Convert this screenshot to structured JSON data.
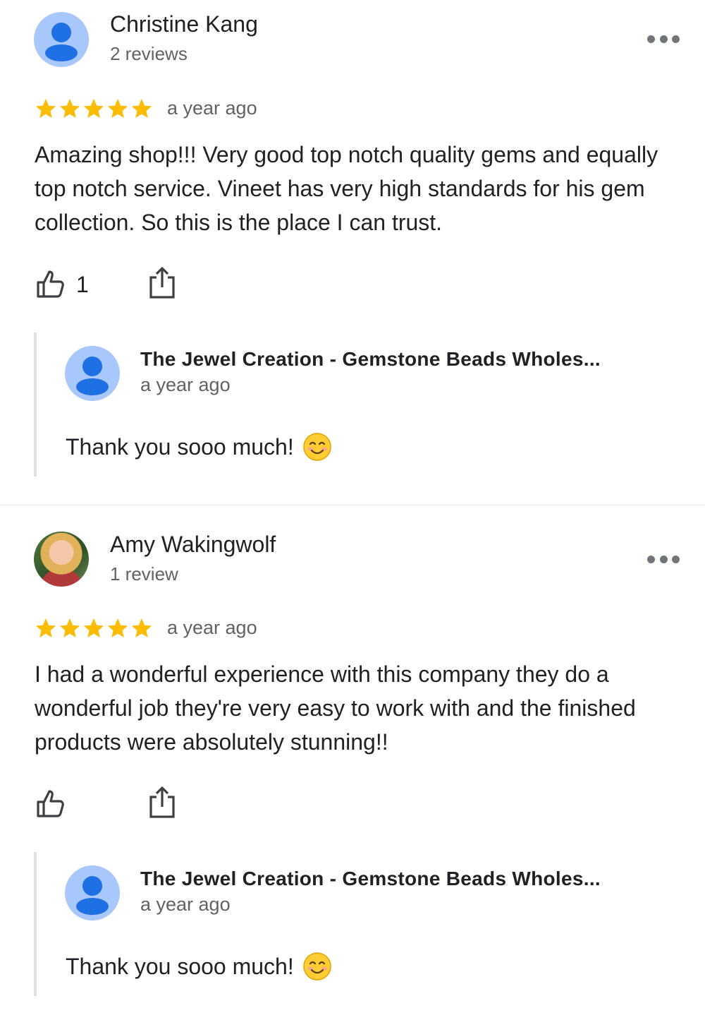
{
  "reviews": [
    {
      "reviewer_name": "Christine Kang",
      "reviewer_count": "2 reviews",
      "rating": 5,
      "time": "a year ago",
      "text": "Amazing shop!!! Very good top notch quality gems and equally top notch service. Vineet has very high standards for his gem collection. So this is the place I can trust.",
      "likes": "1",
      "avatar_icon": "person-placeholder-icon",
      "owner_reply": {
        "name": "The Jewel Creation - Gemstone Beads Wholes...",
        "time": "a year ago",
        "text": "Thank you sooo much!",
        "emoji_icon": "smiling-face-icon"
      }
    },
    {
      "reviewer_name": "Amy Wakingwolf",
      "reviewer_count": "1 review",
      "rating": 5,
      "time": "a year ago",
      "text": "I had a wonderful experience with this company they do a wonderful job they're very easy to work with and the finished products were absolutely stunning!!",
      "likes": "",
      "avatar_icon": "profile-photo",
      "owner_reply": {
        "name": "The Jewel Creation - Gemstone Beads Wholes...",
        "time": "a year ago",
        "text": "Thank you sooo much!",
        "emoji_icon": "smiling-face-icon"
      }
    }
  ],
  "colors": {
    "star": "#fbbc04",
    "avatar_bg": "#a8c7fa",
    "avatar_fg": "#1f6fe5",
    "secondary_text": "#5f6368",
    "icon": "#3c4043"
  }
}
